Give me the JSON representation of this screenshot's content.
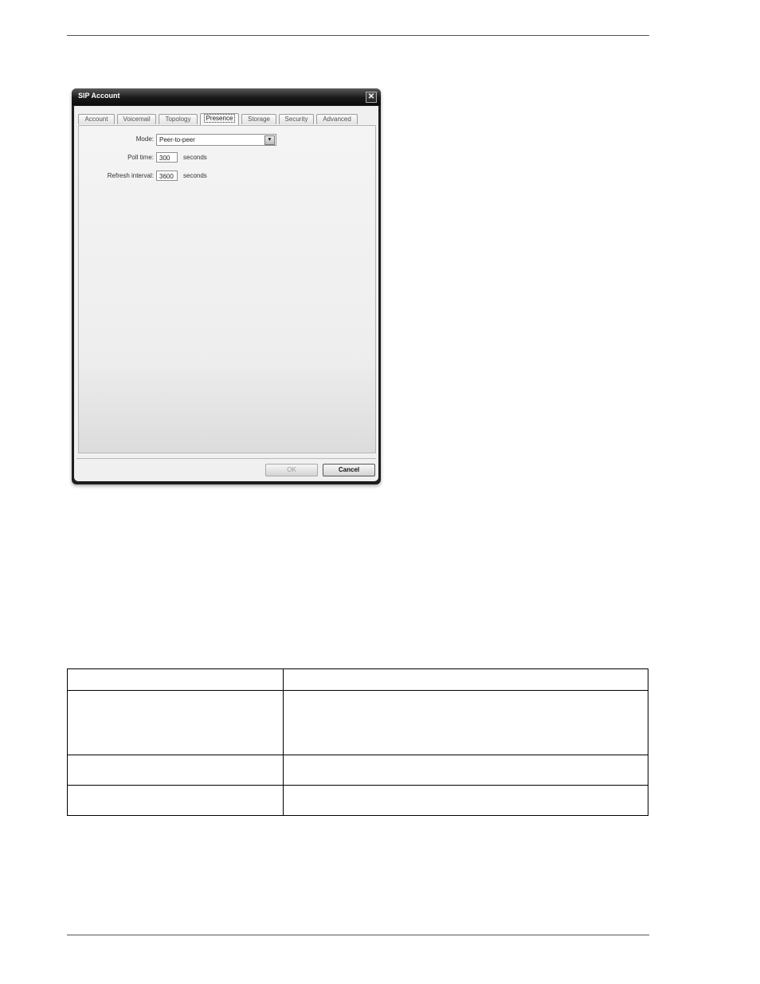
{
  "dialog": {
    "title": "SIP Account",
    "close_glyph": "✕",
    "tabs": [
      {
        "label": "Account",
        "active": false
      },
      {
        "label": "Voicemail",
        "active": false
      },
      {
        "label": "Topology",
        "active": false
      },
      {
        "label": "Presence",
        "active": true
      },
      {
        "label": "Storage",
        "active": false
      },
      {
        "label": "Security",
        "active": false
      },
      {
        "label": "Advanced",
        "active": false
      }
    ],
    "presence": {
      "mode_label": "Mode:",
      "mode_value": "Peer-to-peer",
      "poll_time_label": "Poll time:",
      "poll_time_value": "300",
      "poll_time_unit": "seconds",
      "refresh_interval_label": "Refresh interval:",
      "refresh_interval_value": "3600",
      "refresh_interval_unit": "seconds"
    },
    "buttons": {
      "ok": "OK",
      "cancel": "Cancel"
    }
  },
  "icons": {
    "close": "close-icon",
    "dropdown": "chevron-down-icon"
  },
  "table": {
    "rows": 4,
    "cells": [
      [
        "",
        ""
      ],
      [
        "",
        ""
      ],
      [
        "",
        ""
      ],
      [
        "",
        ""
      ]
    ]
  }
}
